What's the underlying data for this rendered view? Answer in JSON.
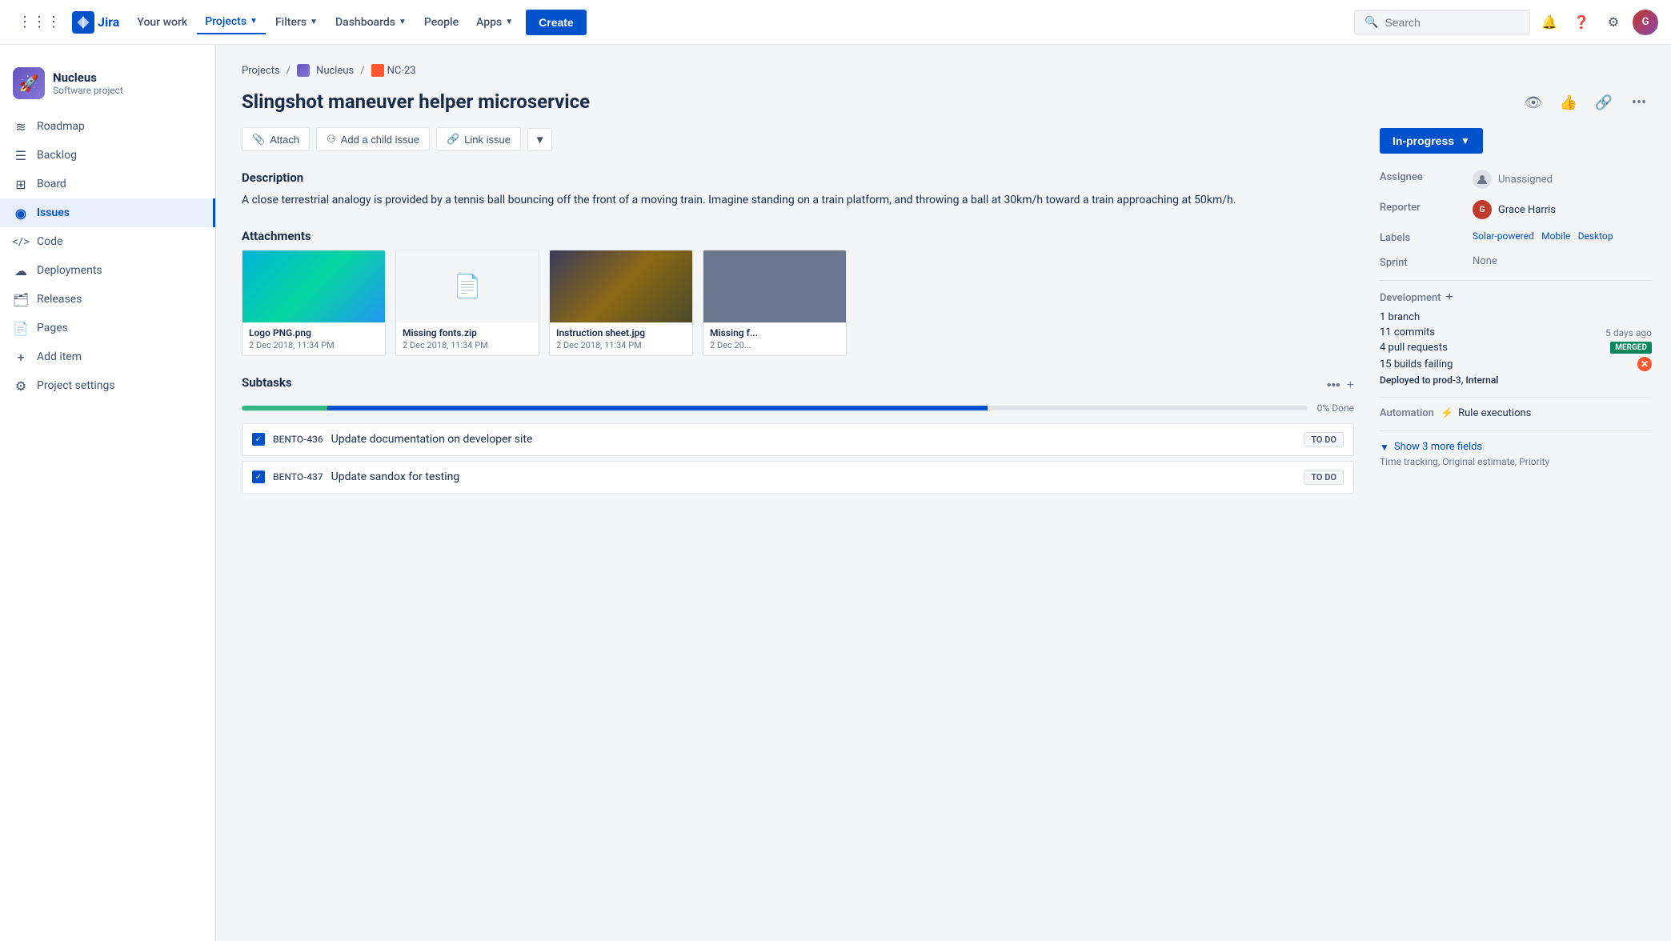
{
  "topnav": {
    "grid_icon": "⊞",
    "logo_text": "Jira",
    "nav_items": [
      {
        "label": "Your work",
        "active": false
      },
      {
        "label": "Projects",
        "active": true,
        "has_dropdown": true
      },
      {
        "label": "Filters",
        "active": false,
        "has_dropdown": true
      },
      {
        "label": "Dashboards",
        "active": false,
        "has_dropdown": true
      },
      {
        "label": "People",
        "active": false
      },
      {
        "label": "Apps",
        "active": false,
        "has_dropdown": true
      }
    ],
    "create_btn": "Create",
    "search_placeholder": "Search"
  },
  "sidebar": {
    "project_name": "Nucleus",
    "project_type": "Software project",
    "nav_items": [
      {
        "label": "Roadmap",
        "icon": "≋"
      },
      {
        "label": "Backlog",
        "icon": "☰"
      },
      {
        "label": "Board",
        "icon": "⊞"
      },
      {
        "label": "Issues",
        "icon": "◉",
        "active": true
      },
      {
        "label": "Code",
        "icon": "</>"
      },
      {
        "label": "Deployments",
        "icon": "↑"
      },
      {
        "label": "Releases",
        "icon": "🗂"
      },
      {
        "label": "Pages",
        "icon": "☐"
      },
      {
        "label": "Add item",
        "icon": "+"
      },
      {
        "label": "Project settings",
        "icon": "⚙"
      }
    ]
  },
  "breadcrumb": {
    "projects": "Projects",
    "nucleus": "Nucleus",
    "issue_id": "NC-23"
  },
  "issue": {
    "title": "Slingshot maneuver helper microservice",
    "status": "In-progress",
    "actions": {
      "attach": "Attach",
      "add_child": "Add a child issue",
      "link_issue": "Link issue"
    },
    "description_title": "Description",
    "description_text": "A close terrestrial analogy is provided by a tennis ball bouncing off the front of a moving train. Imagine standing on a train platform, and throwing a ball at 30km/h toward a train approaching at 50km/h.",
    "attachments_title": "Attachments",
    "attachments": [
      {
        "name": "Logo PNG.png",
        "date": "2 Dec 2018, 11:34 PM",
        "type": "image1"
      },
      {
        "name": "Missing fonts.zip",
        "date": "2 Dec 2018, 11:34 PM",
        "type": "file"
      },
      {
        "name": "Instruction sheet.jpg",
        "date": "2 Dec 2018, 11:34 PM",
        "type": "image3"
      },
      {
        "name": "Missing f...",
        "date": "2 Dec 20...",
        "type": "image4"
      }
    ],
    "subtasks_title": "Subtasks",
    "progress_percent": "0% Done",
    "subtasks": [
      {
        "id": "BENTO-436",
        "name": "Update documentation on developer site",
        "status": "TO DO"
      },
      {
        "id": "BENTO-437",
        "name": "Update sandox for testing",
        "status": "TO DO"
      }
    ]
  },
  "right_panel": {
    "assignee_label": "Assignee",
    "assignee_value": "Unassigned",
    "reporter_label": "Reporter",
    "reporter_value": "Grace Harris",
    "labels_label": "Labels",
    "labels": [
      "Solar-powered",
      "Mobile",
      "Desktop"
    ],
    "sprint_label": "Sprint",
    "sprint_value": "None",
    "development_label": "Development",
    "dev_items": [
      {
        "label": "1 branch",
        "meta": ""
      },
      {
        "label": "11 commits",
        "meta": "5 days ago"
      },
      {
        "label": "4 pull requests",
        "meta": "MERGED"
      },
      {
        "label": "15 builds failing",
        "meta": "error"
      }
    ],
    "deploy_label": "Deployed to",
    "deploy_value": "prod-3, Internal",
    "automation_label": "Automation",
    "automation_value": "Rule executions",
    "show_more_label": "Show 3 more fields",
    "show_more_sub": "Time tracking, Original estimate, Priority"
  }
}
